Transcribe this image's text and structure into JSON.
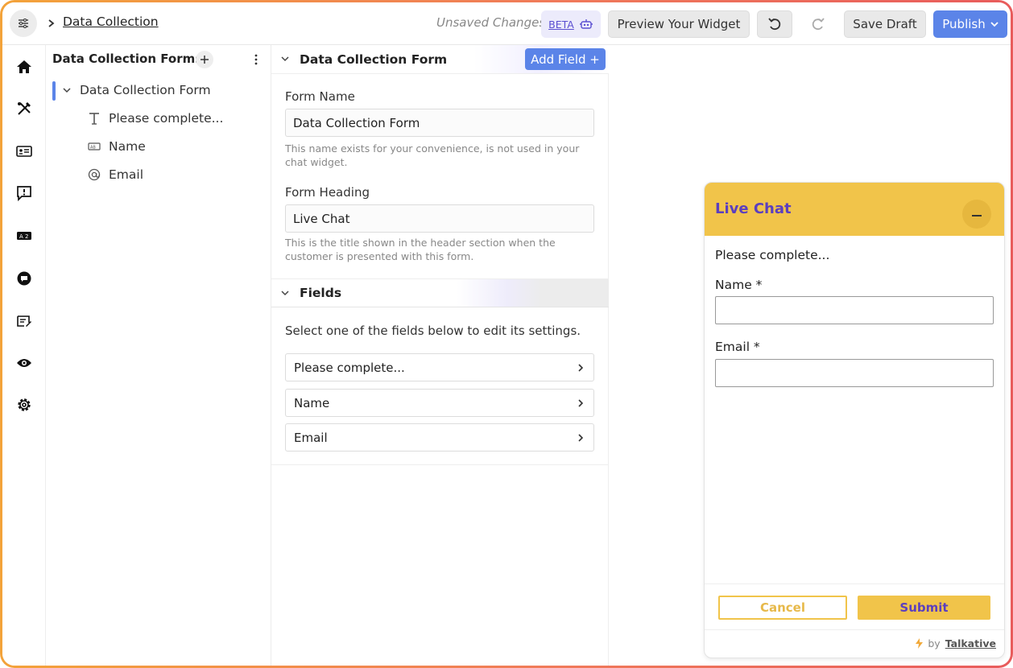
{
  "header": {
    "breadcrumb": "Data Collection",
    "status": "Unsaved Changes",
    "beta_label": "BETA",
    "preview_label": "Preview Your Widget",
    "save_draft_label": "Save Draft",
    "publish_label": "Publish"
  },
  "rail": {
    "items": [
      "home-icon",
      "design-tools-icon",
      "contact-card-icon",
      "alert-message-icon",
      "text-field-icon",
      "chat-bubble-icon",
      "edit-note-icon",
      "eye-icon",
      "gear-icon"
    ]
  },
  "tree": {
    "title": "Data Collection Forms",
    "form": "Data Collection Form",
    "items": [
      {
        "label": "Please complete...",
        "icon": "text-type-icon"
      },
      {
        "label": "Name",
        "icon": "text-input-icon"
      },
      {
        "label": "Email",
        "icon": "at-sign-icon"
      }
    ]
  },
  "editor": {
    "section_title": "Data Collection Form",
    "add_field_label": "Add Field +",
    "form_name_label": "Form Name",
    "form_name_value": "Data Collection Form",
    "form_name_help": "This name exists for your convenience, is not used in your chat widget.",
    "form_heading_label": "Form Heading",
    "form_heading_value": "Live Chat",
    "form_heading_help": "This is the title shown in the header section when the customer is presented with this form.",
    "fields_title": "Fields",
    "fields_intro": "Select one of the fields below to edit its settings.",
    "fields": [
      "Please complete...",
      "Name",
      "Email"
    ]
  },
  "widget": {
    "title": "Live Chat",
    "intro": "Please complete...",
    "name_label": "Name *",
    "email_label": "Email *",
    "cancel_label": "Cancel",
    "submit_label": "Submit",
    "brand_prefix": "by",
    "brand_name": "Talkative"
  },
  "colors": {
    "accent_blue": "#5b84e8",
    "widget_yellow": "#f1c44a",
    "widget_purple": "#5b3fbf"
  }
}
